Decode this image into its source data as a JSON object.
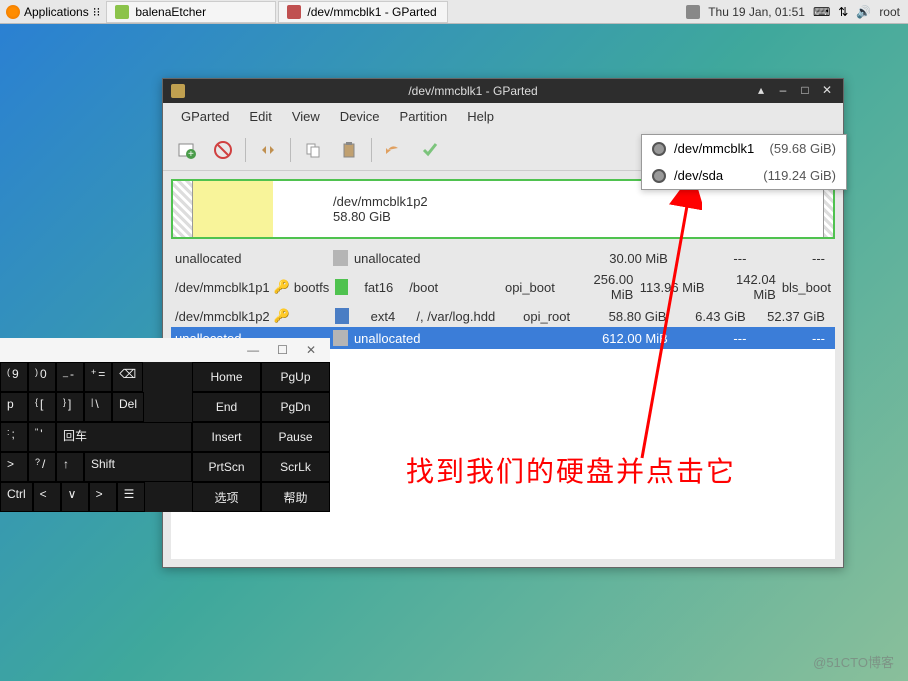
{
  "panel": {
    "applications": "Applications",
    "tasks": [
      "balenaEtcher",
      "/dev/mmcblk1 - GParted"
    ],
    "clock": "Thu 19 Jan, 01:51",
    "user": "root"
  },
  "window": {
    "title": "/dev/mmcblk1 - GParted",
    "menus": [
      "GParted",
      "Edit",
      "View",
      "Device",
      "Partition",
      "Help"
    ],
    "visual": {
      "name": "/dev/mmcblk1p2",
      "size": "58.80 GiB"
    },
    "dropdown": [
      {
        "dev": "/dev/mmcblk1",
        "size": "(59.68 GiB)"
      },
      {
        "dev": "/dev/sda",
        "size": "(119.24 GiB)"
      }
    ],
    "rows": [
      {
        "part": "unallocated",
        "color": "gray",
        "fs": "unallocated",
        "mount": "",
        "label": "",
        "size": "30.00 MiB",
        "used": "---",
        "unused": "---",
        "flags": ""
      },
      {
        "part": "/dev/mmcblk1p1",
        "key": true,
        "color": "green",
        "name": "bootfs",
        "fs": "fat16",
        "mount": "/boot",
        "label": "opi_boot",
        "size": "256.00 MiB",
        "used": "113.96 MiB",
        "unused": "142.04 MiB",
        "flags": "bls_boot"
      },
      {
        "part": "/dev/mmcblk1p2",
        "key": true,
        "color": "blue",
        "name": "",
        "fs": "ext4",
        "mount": "/, /var/log.hdd",
        "label": "opi_root",
        "size": "58.80 GiB",
        "used": "6.43 GiB",
        "unused": "52.37 GiB",
        "flags": ""
      },
      {
        "part": "unallocated",
        "color": "gray",
        "fs": "unallocated",
        "mount": "",
        "label": "",
        "size": "612.00 MiB",
        "used": "---",
        "unused": "---",
        "flags": "",
        "selected": true
      }
    ]
  },
  "osk": {
    "r1": [
      [
        "(",
        "9"
      ],
      [
        ")",
        "0"
      ],
      [
        "_",
        "-"
      ],
      [
        "+",
        "="
      ],
      [
        "⌫",
        ""
      ]
    ],
    "r2": [
      [
        "",
        "p"
      ],
      [
        "{",
        "["
      ],
      [
        "}",
        "]"
      ],
      [
        "|",
        "\\"
      ],
      [
        "Del",
        ""
      ]
    ],
    "r3": [
      [
        ":",
        ";"
      ],
      [
        "\"",
        "'"
      ],
      [
        "回车",
        ""
      ]
    ],
    "r4": [
      [
        "",
        ">"
      ],
      [
        "?",
        "/"
      ],
      [
        "",
        "↑"
      ],
      [
        "Shift",
        ""
      ]
    ],
    "r5": [
      [
        "Ctrl",
        ""
      ],
      [
        "",
        "<"
      ],
      [
        "",
        "∨"
      ],
      [
        "",
        ">"
      ],
      [
        "☰",
        ""
      ]
    ],
    "side": [
      [
        "Home",
        "PgUp"
      ],
      [
        "End",
        "PgDn"
      ],
      [
        "Insert",
        "Pause"
      ],
      [
        "PrtScn",
        "ScrLk"
      ],
      [
        "选项",
        "帮助"
      ]
    ]
  },
  "annotation": "找到我们的硬盘并点击它",
  "watermark": "@51CTO博客"
}
